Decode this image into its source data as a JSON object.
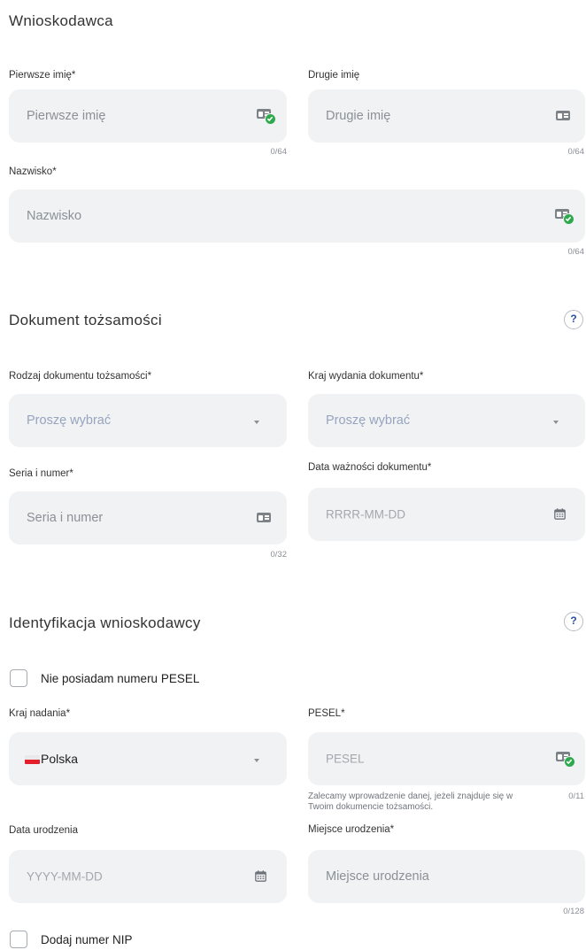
{
  "applicant": {
    "title": "Wnioskodawca",
    "first_name": {
      "label": "Pierwsze imię*",
      "placeholder": "Pierwsze imię",
      "counter": "0/64"
    },
    "second_name": {
      "label": "Drugie imię",
      "placeholder": "Drugie imię",
      "counter": "0/64"
    },
    "surname": {
      "label": "Nazwisko*",
      "placeholder": "Nazwisko",
      "counter": "0/64"
    }
  },
  "identity_document": {
    "title": "Dokument tożsamości",
    "help": "?",
    "doc_type": {
      "label": "Rodzaj dokumentu tożsamości*",
      "value": "Proszę wybrać"
    },
    "issuing_country": {
      "label": "Kraj wydania dokumentu*",
      "value": "Proszę wybrać"
    },
    "series_number": {
      "label": "Seria i numer*",
      "placeholder": "Seria i numer",
      "counter": "0/32"
    },
    "expiry_date": {
      "label": "Data ważności dokumentu*",
      "placeholder": "RRRR-MM-DD"
    }
  },
  "identification": {
    "title": "Identyfikacja wnioskodawcy",
    "help": "?",
    "no_pesel_label": "Nie posiadam numeru PESEL",
    "country": {
      "label": "Kraj nadania*",
      "value": "Polska"
    },
    "pesel": {
      "label": "PESEL*",
      "placeholder": "PESEL",
      "hint": "Zalecamy wprowadzenie danej, jeżeli znajduje się w Twoim dokumencie tożsamości.",
      "counter": "0/11"
    },
    "birth_date": {
      "label": "Data urodzenia",
      "placeholder": "YYYY-MM-DD"
    },
    "birth_place": {
      "label": "Miejsce urodzenia*",
      "placeholder": "Miejsce urodzenia",
      "counter": "0/128"
    },
    "add_nip_label": "Dodaj numer NIP"
  },
  "colors": {
    "field_bg": "#f1f2f4",
    "check_green": "#2fa94e",
    "help_blue": "#2a4ea8",
    "flag_red": "#e41e2b"
  }
}
